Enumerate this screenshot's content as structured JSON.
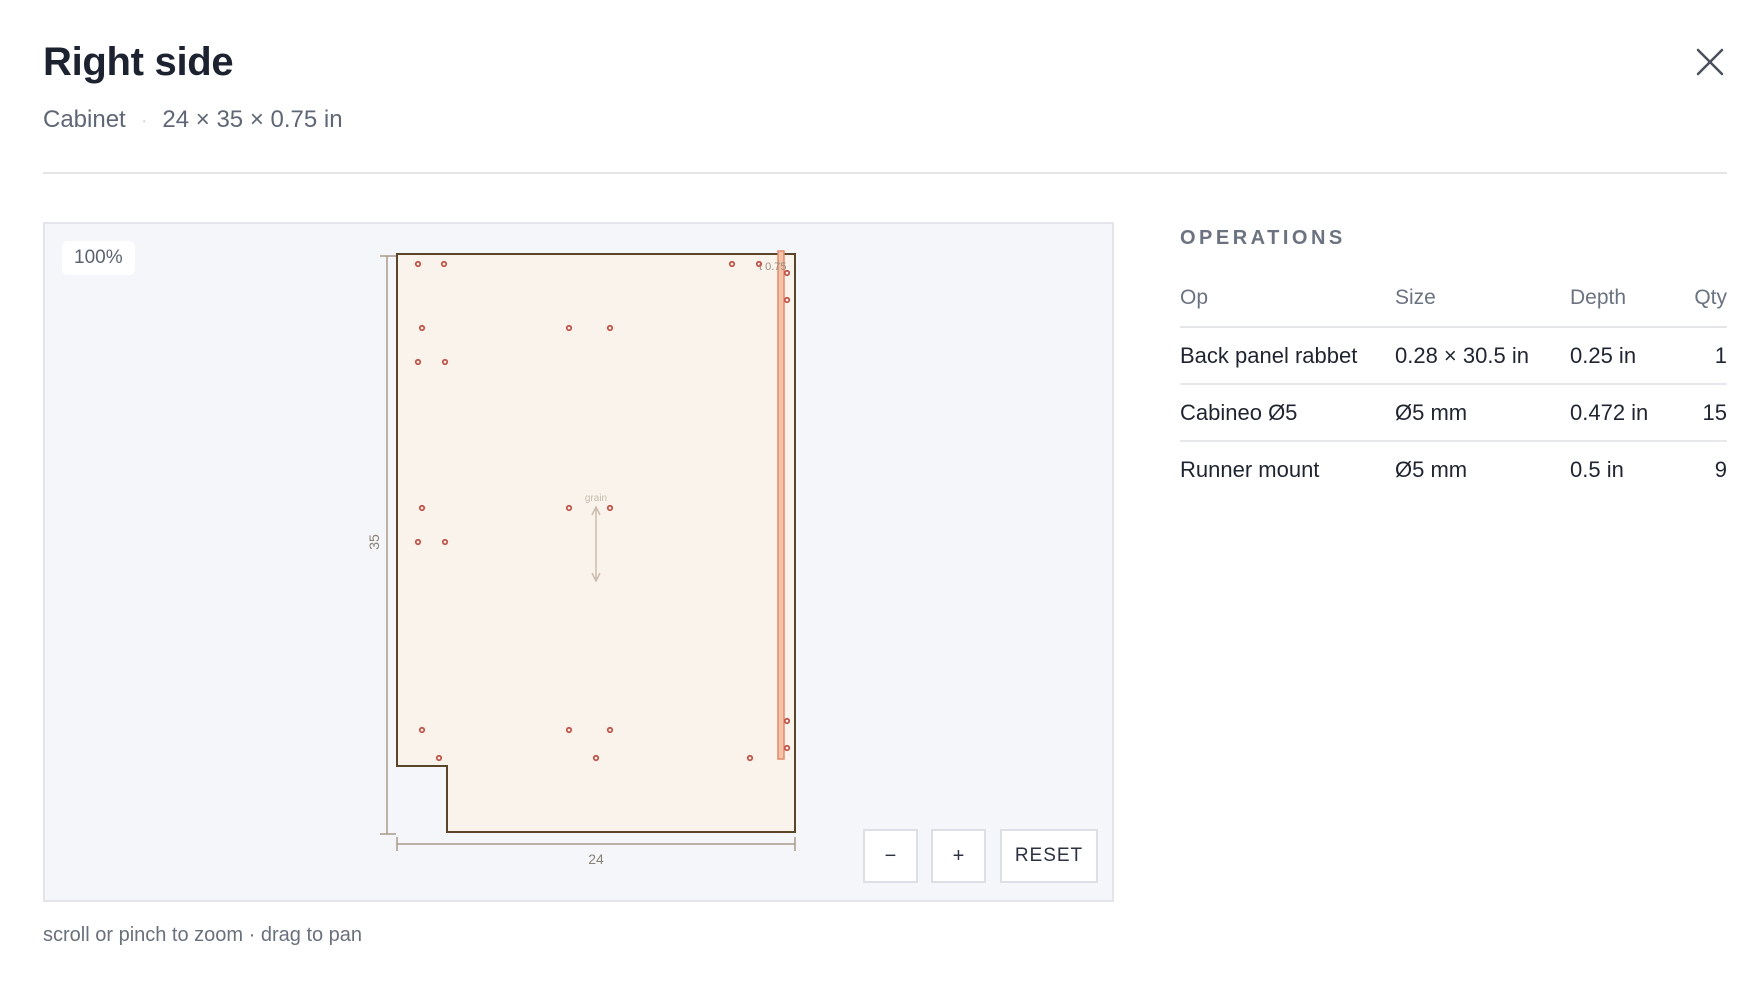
{
  "header": {
    "title": "Right side",
    "category": "Cabinet",
    "separator": "·",
    "dimensions": "24 × 35 × 0.75 in"
  },
  "viewer": {
    "zoom_level": "100%",
    "grain_label": "grain",
    "thickness_label": "t 0.75",
    "dimension_width": "24",
    "dimension_height": "35",
    "zoom_out_label": "−",
    "zoom_in_label": "+",
    "reset_label": "RESET",
    "hint": "scroll or pinch to zoom · drag to pan",
    "colors": {
      "panel_fill": "#f9f3ec",
      "panel_stroke": "#5a4528",
      "rabbet": "#de8b6a",
      "hole": "#c0574c",
      "dimension": "#a89a88"
    }
  },
  "operations": {
    "title": "OPERATIONS",
    "columns": [
      "Op",
      "Size",
      "Depth",
      "Qty"
    ],
    "rows": [
      {
        "op": "Back panel rabbet",
        "size": "0.28 × 30.5 in",
        "depth": "0.25 in",
        "qty": "1"
      },
      {
        "op": "Cabineo Ø5",
        "size": "Ø5 mm",
        "depth": "0.472 in",
        "qty": "15"
      },
      {
        "op": "Runner mount",
        "size": "Ø5 mm",
        "depth": "0.5 in",
        "qty": "9"
      }
    ]
  },
  "icons": {
    "close": "close-icon"
  }
}
